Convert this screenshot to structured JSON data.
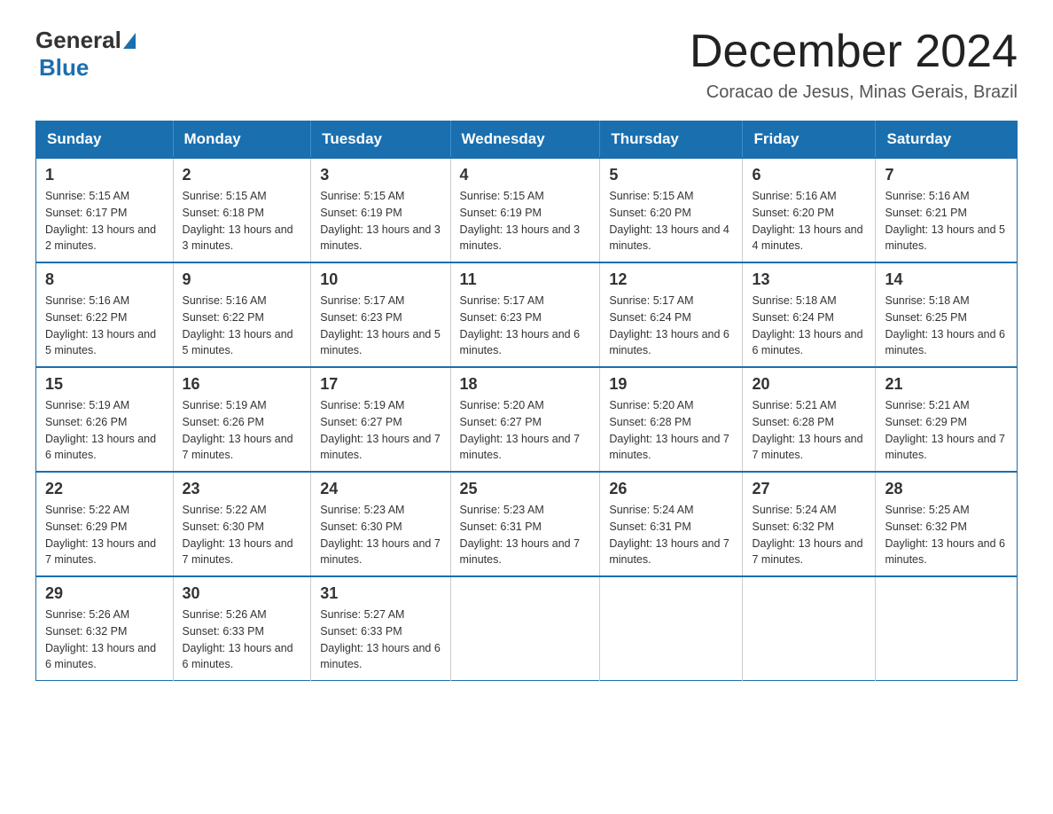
{
  "logo": {
    "general": "General",
    "blue": "Blue"
  },
  "title": "December 2024",
  "subtitle": "Coracao de Jesus, Minas Gerais, Brazil",
  "headers": [
    "Sunday",
    "Monday",
    "Tuesday",
    "Wednesday",
    "Thursday",
    "Friday",
    "Saturday"
  ],
  "weeks": [
    [
      {
        "day": "1",
        "sunrise": "5:15 AM",
        "sunset": "6:17 PM",
        "daylight": "13 hours and 2 minutes."
      },
      {
        "day": "2",
        "sunrise": "5:15 AM",
        "sunset": "6:18 PM",
        "daylight": "13 hours and 3 minutes."
      },
      {
        "day": "3",
        "sunrise": "5:15 AM",
        "sunset": "6:19 PM",
        "daylight": "13 hours and 3 minutes."
      },
      {
        "day": "4",
        "sunrise": "5:15 AM",
        "sunset": "6:19 PM",
        "daylight": "13 hours and 3 minutes."
      },
      {
        "day": "5",
        "sunrise": "5:15 AM",
        "sunset": "6:20 PM",
        "daylight": "13 hours and 4 minutes."
      },
      {
        "day": "6",
        "sunrise": "5:16 AM",
        "sunset": "6:20 PM",
        "daylight": "13 hours and 4 minutes."
      },
      {
        "day": "7",
        "sunrise": "5:16 AM",
        "sunset": "6:21 PM",
        "daylight": "13 hours and 5 minutes."
      }
    ],
    [
      {
        "day": "8",
        "sunrise": "5:16 AM",
        "sunset": "6:22 PM",
        "daylight": "13 hours and 5 minutes."
      },
      {
        "day": "9",
        "sunrise": "5:16 AM",
        "sunset": "6:22 PM",
        "daylight": "13 hours and 5 minutes."
      },
      {
        "day": "10",
        "sunrise": "5:17 AM",
        "sunset": "6:23 PM",
        "daylight": "13 hours and 5 minutes."
      },
      {
        "day": "11",
        "sunrise": "5:17 AM",
        "sunset": "6:23 PM",
        "daylight": "13 hours and 6 minutes."
      },
      {
        "day": "12",
        "sunrise": "5:17 AM",
        "sunset": "6:24 PM",
        "daylight": "13 hours and 6 minutes."
      },
      {
        "day": "13",
        "sunrise": "5:18 AM",
        "sunset": "6:24 PM",
        "daylight": "13 hours and 6 minutes."
      },
      {
        "day": "14",
        "sunrise": "5:18 AM",
        "sunset": "6:25 PM",
        "daylight": "13 hours and 6 minutes."
      }
    ],
    [
      {
        "day": "15",
        "sunrise": "5:19 AM",
        "sunset": "6:26 PM",
        "daylight": "13 hours and 6 minutes."
      },
      {
        "day": "16",
        "sunrise": "5:19 AM",
        "sunset": "6:26 PM",
        "daylight": "13 hours and 7 minutes."
      },
      {
        "day": "17",
        "sunrise": "5:19 AM",
        "sunset": "6:27 PM",
        "daylight": "13 hours and 7 minutes."
      },
      {
        "day": "18",
        "sunrise": "5:20 AM",
        "sunset": "6:27 PM",
        "daylight": "13 hours and 7 minutes."
      },
      {
        "day": "19",
        "sunrise": "5:20 AM",
        "sunset": "6:28 PM",
        "daylight": "13 hours and 7 minutes."
      },
      {
        "day": "20",
        "sunrise": "5:21 AM",
        "sunset": "6:28 PM",
        "daylight": "13 hours and 7 minutes."
      },
      {
        "day": "21",
        "sunrise": "5:21 AM",
        "sunset": "6:29 PM",
        "daylight": "13 hours and 7 minutes."
      }
    ],
    [
      {
        "day": "22",
        "sunrise": "5:22 AM",
        "sunset": "6:29 PM",
        "daylight": "13 hours and 7 minutes."
      },
      {
        "day": "23",
        "sunrise": "5:22 AM",
        "sunset": "6:30 PM",
        "daylight": "13 hours and 7 minutes."
      },
      {
        "day": "24",
        "sunrise": "5:23 AM",
        "sunset": "6:30 PM",
        "daylight": "13 hours and 7 minutes."
      },
      {
        "day": "25",
        "sunrise": "5:23 AM",
        "sunset": "6:31 PM",
        "daylight": "13 hours and 7 minutes."
      },
      {
        "day": "26",
        "sunrise": "5:24 AM",
        "sunset": "6:31 PM",
        "daylight": "13 hours and 7 minutes."
      },
      {
        "day": "27",
        "sunrise": "5:24 AM",
        "sunset": "6:32 PM",
        "daylight": "13 hours and 7 minutes."
      },
      {
        "day": "28",
        "sunrise": "5:25 AM",
        "sunset": "6:32 PM",
        "daylight": "13 hours and 6 minutes."
      }
    ],
    [
      {
        "day": "29",
        "sunrise": "5:26 AM",
        "sunset": "6:32 PM",
        "daylight": "13 hours and 6 minutes."
      },
      {
        "day": "30",
        "sunrise": "5:26 AM",
        "sunset": "6:33 PM",
        "daylight": "13 hours and 6 minutes."
      },
      {
        "day": "31",
        "sunrise": "5:27 AM",
        "sunset": "6:33 PM",
        "daylight": "13 hours and 6 minutes."
      },
      null,
      null,
      null,
      null
    ]
  ]
}
